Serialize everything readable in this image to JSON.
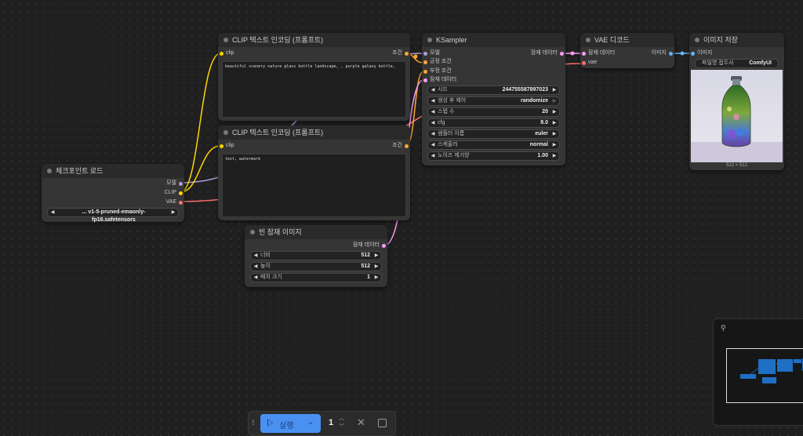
{
  "nodes": {
    "clip_pos": {
      "title": "CLIP 텍스트 인코딩 (프롬프트)",
      "in_clip": "clip",
      "out_cond": "조건",
      "text": "beautiful scenery nature glass bottle landscape, , purple galaxy bottle,"
    },
    "clip_neg": {
      "title": "CLIP 텍스트 인코딩 (프롬프트)",
      "in_clip": "clip",
      "out_cond": "조건",
      "text": "text, watermark"
    },
    "checkpoint": {
      "title": "체크포인트 로드",
      "out_model": "모델",
      "out_clip": "CLIP",
      "out_vae": "VAE",
      "ckpt_value": "... v1-5-pruned-emaonly-fp16.safetensors"
    },
    "empty_latent": {
      "title": "빈 잠재 이미지",
      "out_latent": "잠재 데이터",
      "width_label": "너비",
      "width_value": "512",
      "height_label": "높이",
      "height_value": "512",
      "batch_label": "배치 크기",
      "batch_value": "1"
    },
    "ksampler": {
      "title": "KSampler",
      "in_model": "모델",
      "in_positive": "긍정 조건",
      "in_negative": "부정 조건",
      "in_latent": "잠재 데이터",
      "out_latent": "잠재 데이터",
      "widgets": [
        {
          "label": "시드",
          "value": "244755587897023"
        },
        {
          "label": "생성 후 제어",
          "value": "randomize"
        },
        {
          "label": "스텝 수",
          "value": "20"
        },
        {
          "label": "cfg",
          "value": "8.0"
        },
        {
          "label": "샘플러 이름",
          "value": "euler"
        },
        {
          "label": "스케줄러",
          "value": "normal"
        },
        {
          "label": "노이즈 제거양",
          "value": "1.00"
        }
      ]
    },
    "vae_decode": {
      "title": "VAE 디코드",
      "in_samples": "잠재 데이터",
      "in_vae": "vae",
      "out_image": "이미지"
    },
    "save_image": {
      "title": "이미지 저장",
      "in_images": "이미지",
      "prefix_label": "파일명 접두사",
      "prefix_value": "ComfyUI",
      "size_caption": "512 × 512"
    }
  },
  "toolbar": {
    "run_label": "실행",
    "batch_count": "1"
  },
  "colors": {
    "model": "#b39ddb",
    "clip": "#ffd500",
    "vae": "#ff6e6e",
    "conditioning": "#ffa931",
    "latent": "#ff9cf9",
    "image": "#64b5f6",
    "run_button": "#4a90f0"
  },
  "icons": {
    "drag_handle": "drag-handle-icon",
    "run": "play-icon",
    "dropdown": "chevron-down-icon",
    "stepper": "stepper-icon",
    "cancel": "close-icon",
    "stop": "stop-square-icon",
    "minimap_settings": "settings-sliders-icon"
  }
}
